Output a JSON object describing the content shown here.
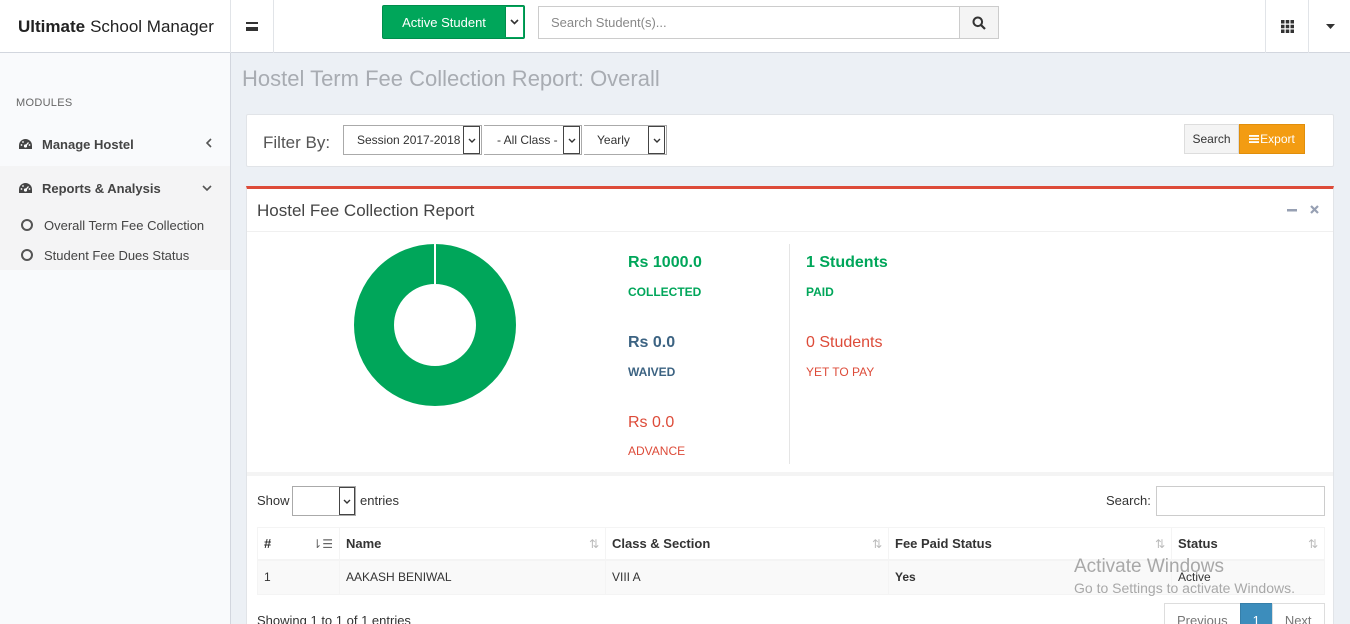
{
  "app": {
    "brand_bold": "Ultimate",
    "brand_rest": "School Manager"
  },
  "header": {
    "active_student_label": "Active Student",
    "search_placeholder": "Search Student(s)..."
  },
  "sidebar": {
    "modules_header": "MODULES",
    "items": [
      {
        "label": "Manage Hostel",
        "icon": "dashboard-icon",
        "arrow": "‹"
      },
      {
        "label": "Reports & Analysis",
        "icon": "dashboard-icon",
        "arrow": "⌄"
      }
    ],
    "sub_items": [
      {
        "label": "Overall Term Fee Collection"
      },
      {
        "label": "Student Fee Dues Status"
      }
    ]
  },
  "page": {
    "title": "Hostel Term Fee Collection Report: Overall"
  },
  "filter": {
    "label": "Filter By:",
    "session": "Session 2017-2018",
    "class": "- All Class -",
    "period": "Yearly",
    "search_label": "Search",
    "export_label": "Export"
  },
  "report": {
    "title": "Hostel Fee Collection Report",
    "collected_value": "Rs 1000.0",
    "collected_label": "COLLECTED",
    "waived_value": "Rs 0.0",
    "waived_label": "WAIVED",
    "advance_value": "Rs 0.0",
    "advance_label": "ADVANCE",
    "paid_value": "1 Students",
    "paid_label": "PAID",
    "unpaid_value": "0 Students",
    "unpaid_label": "YET TO PAY",
    "colors": {
      "green": "#00a65a",
      "blue": "#3c6382",
      "red": "#dd4b39",
      "accent_top": "#dd4b39"
    },
    "donut": {
      "collected": 1000.0,
      "waived": 0.0,
      "advance": 0.0
    }
  },
  "table": {
    "show_label": "Show",
    "entries_label": "entries",
    "search_label": "Search:",
    "columns": [
      "#",
      "Name",
      "Class & Section",
      "Fee Paid Status",
      "Status"
    ],
    "rows": [
      {
        "num": "1",
        "name": "AAKASH BENIWAL",
        "class": "VIII A",
        "fee_paid": "Yes",
        "status": "Active"
      }
    ],
    "showing_text": "Showing 1 to 1 of 1 entries",
    "pagination": {
      "prev": "Previous",
      "current": "1",
      "next": "Next"
    }
  },
  "watermark": {
    "line1": "Activate Windows",
    "line2": "Go to Settings to activate Windows."
  }
}
